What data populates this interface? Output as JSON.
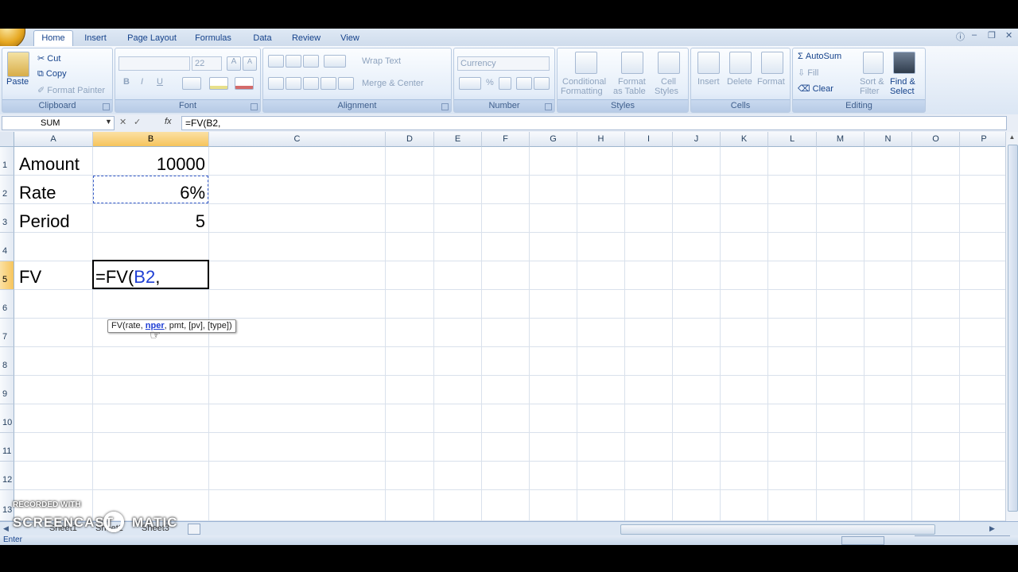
{
  "tabs": [
    {
      "label": "Home",
      "active": true
    },
    {
      "label": "Insert"
    },
    {
      "label": "Page Layout"
    },
    {
      "label": "Formulas"
    },
    {
      "label": "Data"
    },
    {
      "label": "Review"
    },
    {
      "label": "View"
    }
  ],
  "ribbon": {
    "clipboard": {
      "label": "Clipboard",
      "paste": "Paste",
      "cut": "Cut",
      "copy": "Copy",
      "format_painter": "Format Painter"
    },
    "font": {
      "label": "Font",
      "size": "22",
      "bold": "B",
      "italic": "I",
      "underline": "U"
    },
    "alignment": {
      "label": "Alignment",
      "wrap_text": "Wrap Text",
      "merge_center": "Merge & Center"
    },
    "number": {
      "label": "Number",
      "format": "Currency",
      "percent": "%"
    },
    "styles": {
      "label": "Styles",
      "conditional": "Conditional",
      "formatting": "Formatting",
      "format": "Format",
      "as_table": "as Table",
      "cell": "Cell",
      "cell_styles": "Styles"
    },
    "cells": {
      "label": "Cells",
      "insert": "Insert",
      "delete": "Delete",
      "format": "Format"
    },
    "editing": {
      "label": "Editing",
      "autosum": "AutoSum",
      "fill": "Fill",
      "clear": "Clear",
      "sort": "Sort &",
      "filter": "Filter",
      "find": "Find &",
      "select": "Select"
    }
  },
  "formula_bar": {
    "name_box": "SUM",
    "fx": "fx",
    "formula": "=FV(B2,"
  },
  "columns": [
    "A",
    "B",
    "C",
    "D",
    "E",
    "F",
    "G",
    "H",
    "I",
    "J",
    "K",
    "L",
    "M",
    "N",
    "O",
    "P"
  ],
  "rows": [
    "1",
    "2",
    "3",
    "4",
    "5",
    "6",
    "7",
    "8",
    "9",
    "10",
    "11",
    "12",
    "13"
  ],
  "cells": {
    "a1": "Amount",
    "b1": "10000",
    "a2": "Rate",
    "b2": "6%",
    "a3": "Period",
    "b3": "5",
    "a5": "FV",
    "b5_prefix": "=FV(",
    "b5_ref": "B2",
    "b5_suffix": ","
  },
  "tooltip": {
    "prefix": "FV(rate, ",
    "bold": "nper",
    "suffix": ", pmt, [pv], [type])"
  },
  "status": {
    "mode": "Enter"
  },
  "sheets": [
    "Sheet1",
    "Sheet2",
    "Sheet3"
  ],
  "watermark": {
    "line1": "RECORDED WITH",
    "line2": "SCREENCAST",
    "line3": "MATIC"
  },
  "colors": {
    "ref_blue": "#1f3fd4",
    "selection_orange": "#f6c45c",
    "ribbon_text": "#15428b"
  }
}
